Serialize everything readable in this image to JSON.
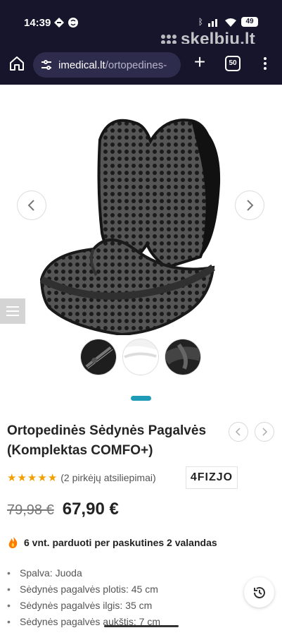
{
  "status_bar": {
    "time": "14:39",
    "battery": "49",
    "watermark": "skelbiu.lt"
  },
  "browser": {
    "url_host": "imedical.lt",
    "url_path": "/ortopedines-",
    "tab_count": "50"
  },
  "gallery": {
    "active_slide": 1,
    "icons": {
      "previous": "chevron-left-icon",
      "next": "chevron-right-icon",
      "side_menu": "hamburger-icon"
    }
  },
  "product": {
    "title": "Ortopedinės Sėdynės Pagalvės (Komplektas COMFO+)",
    "rating": 5,
    "reviews": "(2 pirkėjų atsiliepimai)",
    "brand": "4FIZJO",
    "old_price": "79,98 €",
    "price": "67,90 €",
    "sold_notice": "6 vnt. parduoti per paskutines 2 valandas",
    "specs": [
      "Spalva: Juoda",
      "Sėdynės pagalvės plotis: 45 cm",
      "Sėdynės pagalvės ilgis: 35 cm",
      "Sėdynės pagalvės aukštis: 7 cm"
    ]
  },
  "colors": {
    "browser_bg": "#16152b",
    "url_bg": "#2d2c4c",
    "accent": "#1e9bb7",
    "star": "#f1a000"
  }
}
